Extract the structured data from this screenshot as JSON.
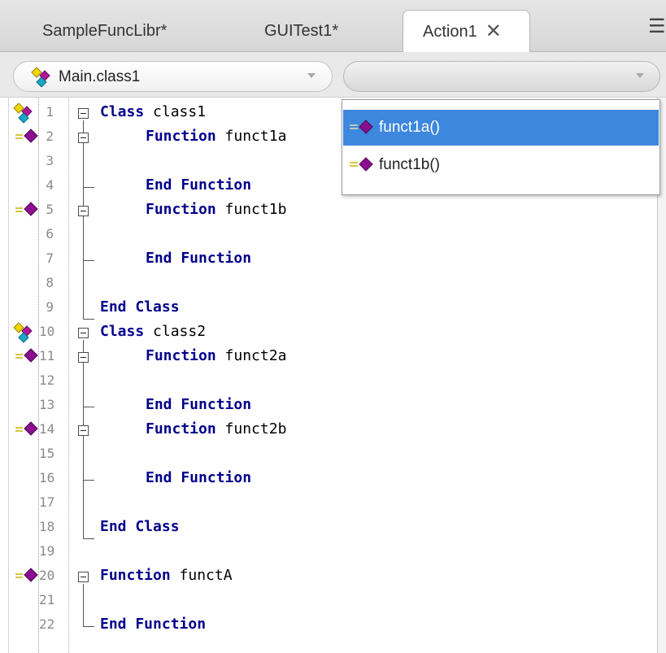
{
  "tabs": [
    {
      "label": "SampleFuncLibr*",
      "active": false
    },
    {
      "label": "GUITest1*",
      "active": false
    },
    {
      "label": "Action1",
      "active": true,
      "close_glyph": "✕"
    }
  ],
  "overflow_glyph": "☰",
  "class_selector": {
    "value": "Main.class1",
    "icon": "class-icon"
  },
  "function_selector": {
    "value": "",
    "icon": "dropdown-arrow-icon"
  },
  "dropdown": {
    "items": [
      {
        "label": "funct1a()",
        "icon": "method-icon",
        "selected": true
      },
      {
        "label": "funct1b()",
        "icon": "method-icon",
        "selected": false
      }
    ]
  },
  "editor": {
    "lines": [
      {
        "num": "1",
        "kw": "Class",
        "name": "class1",
        "marker": "class-icon"
      },
      {
        "num": "2",
        "kw": "Function",
        "name": "funct1a",
        "marker": "method-icon"
      },
      {
        "num": "3",
        "kw": "",
        "name": "",
        "marker": ""
      },
      {
        "num": "4",
        "kw": "End Function",
        "name": "",
        "marker": ""
      },
      {
        "num": "5",
        "kw": "Function",
        "name": "funct1b",
        "marker": "method-icon"
      },
      {
        "num": "6",
        "kw": "",
        "name": "",
        "marker": ""
      },
      {
        "num": "7",
        "kw": "End Function",
        "name": "",
        "marker": ""
      },
      {
        "num": "8",
        "kw": "",
        "name": "",
        "marker": ""
      },
      {
        "num": "9",
        "kw": "End Class",
        "name": "",
        "marker": ""
      },
      {
        "num": "10",
        "kw": "Class",
        "name": "class2",
        "marker": "class-icon"
      },
      {
        "num": "11",
        "kw": "Function",
        "name": "funct2a",
        "marker": "method-icon"
      },
      {
        "num": "12",
        "kw": "",
        "name": "",
        "marker": ""
      },
      {
        "num": "13",
        "kw": "End Function",
        "name": "",
        "marker": ""
      },
      {
        "num": "14",
        "kw": "Function",
        "name": "funct2b",
        "marker": "method-icon"
      },
      {
        "num": "15",
        "kw": "",
        "name": "",
        "marker": ""
      },
      {
        "num": "16",
        "kw": "End Function",
        "name": "",
        "marker": ""
      },
      {
        "num": "17",
        "kw": "",
        "name": "",
        "marker": ""
      },
      {
        "num": "18",
        "kw": "End Class",
        "name": "",
        "marker": ""
      },
      {
        "num": "19",
        "kw": "",
        "name": "",
        "marker": ""
      },
      {
        "num": "20",
        "kw": "Function",
        "name": "functA",
        "marker": "method-icon"
      },
      {
        "num": "21",
        "kw": "",
        "name": "",
        "marker": ""
      },
      {
        "num": "22",
        "kw": "End Function",
        "name": "",
        "marker": ""
      }
    ]
  },
  "colors": {
    "keyword": "#00008b",
    "selection": "#3d87de",
    "class_icon_yellow": "#f2d600",
    "class_icon_magenta": "#b0169a",
    "class_icon_cyan": "#19a8c8",
    "method_icon_purple": "#8a0f8f"
  }
}
